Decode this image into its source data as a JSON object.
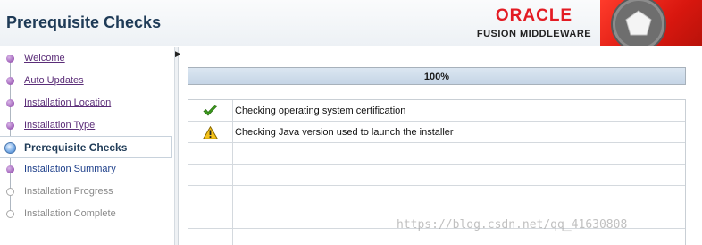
{
  "header": {
    "title": "Prerequisite Checks",
    "brand": "ORACLE",
    "product": "FUSION MIDDLEWARE",
    "brand_color": "#e31b23"
  },
  "sidebar": {
    "items": [
      {
        "label": "Welcome",
        "state": "done"
      },
      {
        "label": "Auto Updates",
        "state": "done"
      },
      {
        "label": "Installation Location",
        "state": "done"
      },
      {
        "label": "Installation Type",
        "state": "done"
      },
      {
        "label": "Prerequisite Checks",
        "state": "current"
      },
      {
        "label": "Installation Summary",
        "state": "todo"
      },
      {
        "label": "Installation Progress",
        "state": "disabled"
      },
      {
        "label": "Installation Complete",
        "state": "disabled"
      }
    ]
  },
  "progress": {
    "label": "100%",
    "value": 1.0
  },
  "checks": [
    {
      "icon": "check-icon",
      "status": "success",
      "text": "Checking operating system certification"
    },
    {
      "icon": "warning-icon",
      "status": "warning",
      "text": "Checking Java version used to launch the installer"
    },
    {
      "icon": "",
      "status": "",
      "text": ""
    },
    {
      "icon": "",
      "status": "",
      "text": ""
    },
    {
      "icon": "",
      "status": "",
      "text": ""
    },
    {
      "icon": "",
      "status": "",
      "text": ""
    },
    {
      "icon": "",
      "status": "",
      "text": ""
    }
  ],
  "watermark": "https://blog.csdn.net/qq_41630808"
}
